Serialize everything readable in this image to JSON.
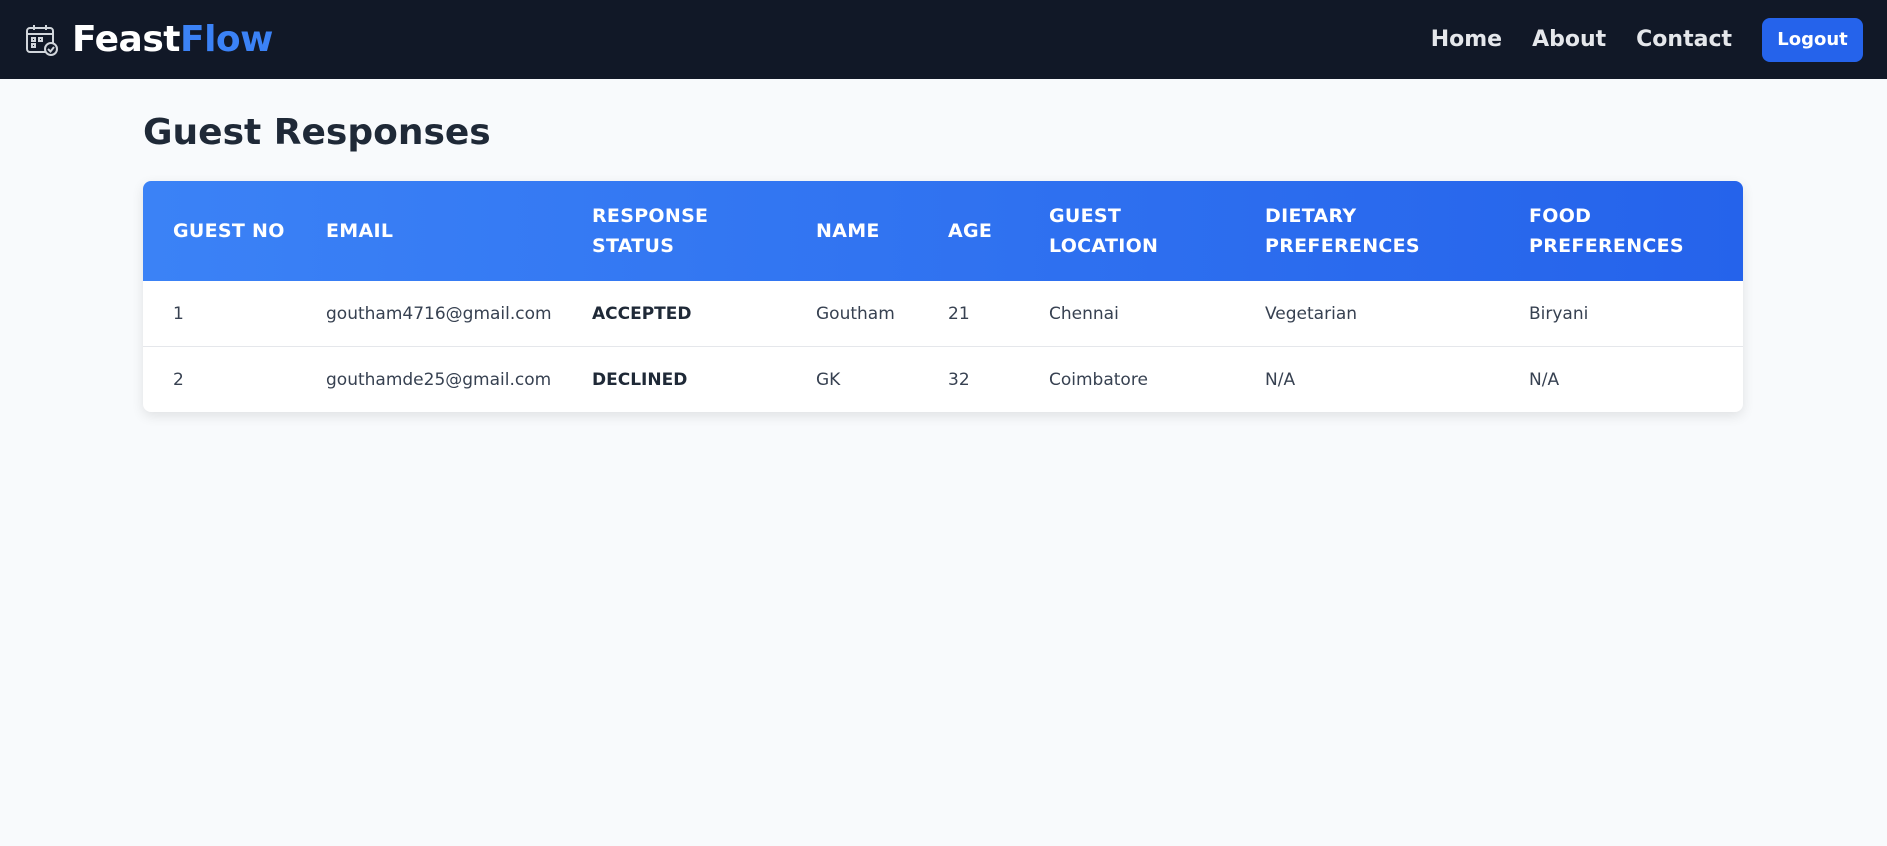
{
  "navbar": {
    "brand_part_1": "Feast",
    "brand_part_2": "Flow",
    "links": [
      "Home",
      "About",
      "Contact"
    ],
    "logout_label": "Logout"
  },
  "page": {
    "title": "Guest Responses"
  },
  "table": {
    "headers": [
      "GUEST NO",
      "EMAIL",
      "RESPONSE STATUS",
      "NAME",
      "AGE",
      "GUEST LOCATION",
      "DIETARY PREFERENCES",
      "FOOD PREFERENCES"
    ],
    "rows": [
      [
        "1",
        "goutham4716@gmail.com",
        "ACCEPTED",
        "Goutham",
        "21",
        "Chennai",
        "Vegetarian",
        "Biryani"
      ],
      [
        "2",
        "gouthamde25@gmail.com",
        "DECLINED",
        "GK",
        "32",
        "Coimbatore",
        "N/A",
        "N/A"
      ]
    ]
  },
  "colors": {
    "navbar_bg": "#111827",
    "accent": "#3b82f6",
    "button": "#2563eb"
  }
}
